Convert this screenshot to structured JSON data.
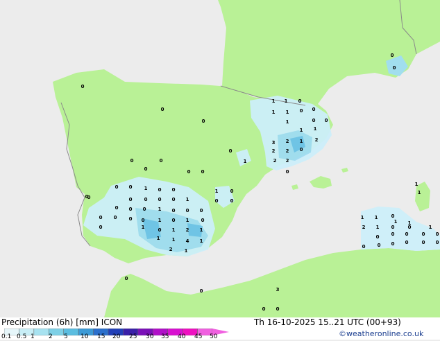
{
  "footer": {
    "title": "Precipitation (6h) [mm] ICON",
    "timestamp": "Th 16-10-2025 15..21 UTC (00+93)",
    "credit": "©weatheronline.co.uk"
  },
  "legend": {
    "ticks": [
      "0.1",
      "0.5",
      "1",
      "2",
      "5",
      "10",
      "15",
      "20",
      "25",
      "30",
      "35",
      "40",
      "45",
      "50"
    ],
    "colors": [
      "#e6f6fa",
      "#c8eef6",
      "#a7e2f0",
      "#7ed0e6",
      "#5bbde0",
      "#3c9ad6",
      "#2b6fcc",
      "#2240b8",
      "#3a1fa8",
      "#7a10b8",
      "#b010c8",
      "#d810d0",
      "#ee10c0",
      "#f060e0"
    ]
  },
  "colors": {
    "land": "#b9f196",
    "sea": "#ececec",
    "border": "#8a8a8a",
    "rain_light": "#cdeffa",
    "rain_medium": "#9fdcf2",
    "rain_heavy": "#6cc2ea"
  },
  "values": [
    {
      "t": "0"
    },
    {
      "t": "0"
    },
    {
      "t": "0"
    },
    {
      "t": "0"
    },
    {
      "t": "0"
    },
    {
      "t": "0"
    },
    {
      "t": "0"
    },
    {
      "t": "0"
    },
    {
      "t": "1"
    },
    {
      "t": "1"
    },
    {
      "t": "0"
    },
    {
      "t": "0"
    },
    {
      "t": "1"
    },
    {
      "t": "1"
    },
    {
      "t": "0"
    },
    {
      "t": "0"
    },
    {
      "t": "1"
    },
    {
      "t": "1"
    },
    {
      "t": "1"
    },
    {
      "t": "0"
    },
    {
      "t": "3"
    },
    {
      "t": "2"
    },
    {
      "t": "1"
    },
    {
      "t": "2"
    },
    {
      "t": "2"
    },
    {
      "t": "2"
    },
    {
      "t": "0"
    },
    {
      "t": "2"
    },
    {
      "t": "2"
    },
    {
      "t": "0"
    },
    {
      "t": "0"
    },
    {
      "t": "0"
    },
    {
      "t": "0"
    },
    {
      "t": "0"
    },
    {
      "t": "0"
    },
    {
      "t": "1"
    },
    {
      "t": "0"
    },
    {
      "t": "0"
    },
    {
      "t": "1"
    },
    {
      "t": "0"
    },
    {
      "t": "0"
    },
    {
      "t": "0"
    },
    {
      "t": "0"
    },
    {
      "t": "0"
    },
    {
      "t": "0"
    },
    {
      "t": "1"
    },
    {
      "t": "0"
    },
    {
      "t": "0"
    },
    {
      "t": "0"
    },
    {
      "t": "1"
    },
    {
      "t": "0"
    },
    {
      "t": "0"
    },
    {
      "t": "0"
    },
    {
      "t": "1"
    },
    {
      "t": "0"
    },
    {
      "t": "0"
    },
    {
      "t": "0"
    },
    {
      "t": "0"
    },
    {
      "t": "0"
    },
    {
      "t": "0"
    },
    {
      "t": "0"
    },
    {
      "t": "1"
    },
    {
      "t": "0"
    },
    {
      "t": "1"
    },
    {
      "t": "0"
    },
    {
      "t": "0"
    },
    {
      "t": "1"
    },
    {
      "t": "0"
    },
    {
      "t": "1"
    },
    {
      "t": "2"
    },
    {
      "t": "1"
    },
    {
      "t": "1"
    },
    {
      "t": "1"
    },
    {
      "t": "4"
    },
    {
      "t": "1"
    },
    {
      "t": "2"
    },
    {
      "t": "1"
    },
    {
      "t": "1"
    },
    {
      "t": "1"
    },
    {
      "t": "1"
    },
    {
      "t": "1"
    },
    {
      "t": "0"
    },
    {
      "t": "2"
    },
    {
      "t": "1"
    },
    {
      "t": "0"
    },
    {
      "t": "0"
    },
    {
      "t": "0"
    },
    {
      "t": "0"
    },
    {
      "t": "0"
    },
    {
      "t": "0"
    },
    {
      "t": "0"
    },
    {
      "t": "0"
    },
    {
      "t": "0"
    },
    {
      "t": "0"
    },
    {
      "t": "0"
    },
    {
      "t": "0"
    },
    {
      "t": "0"
    },
    {
      "t": "0"
    },
    {
      "t": "3"
    },
    {
      "t": "0"
    },
    {
      "t": "0"
    },
    {
      "t": "1"
    },
    {
      "t": "1"
    },
    {
      "t": "1"
    },
    {
      "t": "0"
    }
  ]
}
